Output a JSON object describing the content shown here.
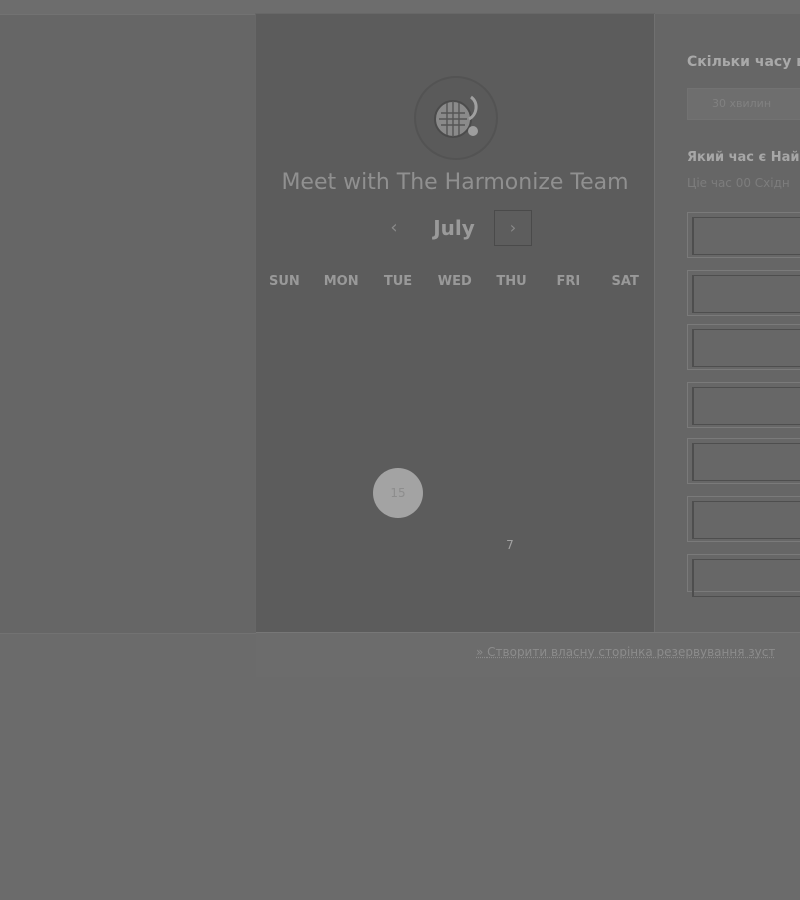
{
  "scheduler": {
    "title": "Meet with The Harmonize Team",
    "month": "July",
    "prev_icon": "chevron-left-icon",
    "next_icon": "chevron-right-icon",
    "weekdays": [
      "SUN",
      "MON",
      "TUE",
      "WED",
      "THU",
      "FRI",
      "SAT"
    ],
    "selected_day": "15",
    "other_day": "7"
  },
  "right_panel": {
    "duration_heading": "Скільки часу в",
    "duration_option": "30 хвилин",
    "time_heading": "Який час є Най",
    "timezone_note": "Ціе час 00 Східн"
  },
  "footer": {
    "link_text": "Створити власну сторінка резервування зуст"
  }
}
